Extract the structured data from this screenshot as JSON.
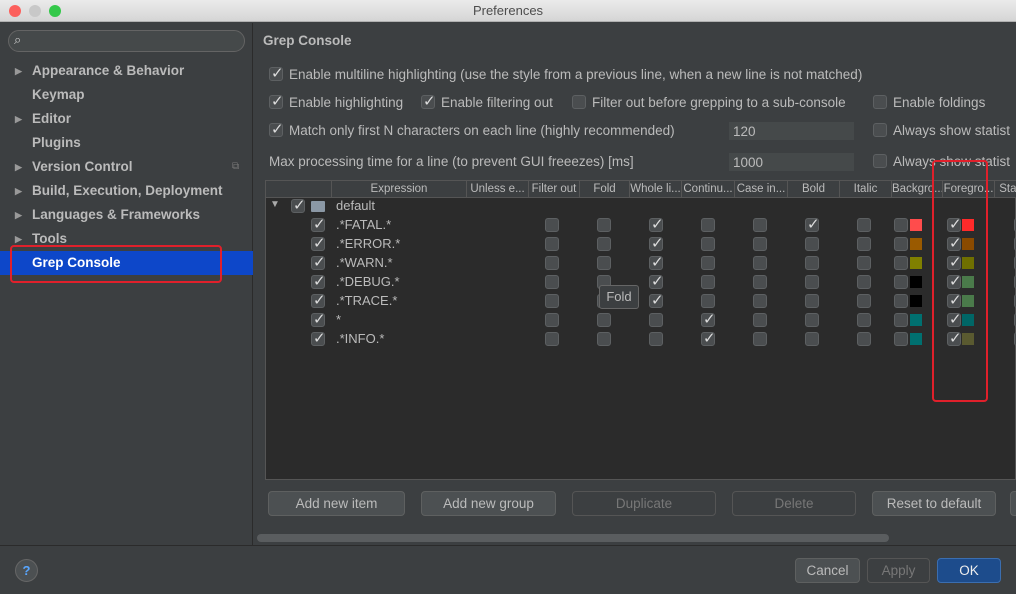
{
  "window": {
    "title": "Preferences"
  },
  "sidebar": {
    "search_placeholder": "",
    "items": [
      {
        "label": "Appearance & Behavior",
        "expandable": true
      },
      {
        "label": "Keymap",
        "expandable": false
      },
      {
        "label": "Editor",
        "expandable": true
      },
      {
        "label": "Plugins",
        "expandable": false
      },
      {
        "label": "Version Control",
        "expandable": true
      },
      {
        "label": "Build, Execution, Deployment",
        "expandable": true
      },
      {
        "label": "Languages & Frameworks",
        "expandable": true
      },
      {
        "label": "Tools",
        "expandable": true
      },
      {
        "label": "Grep Console",
        "expandable": false,
        "selected": true
      }
    ]
  },
  "main": {
    "title": "Grep Console",
    "options": {
      "multiline": {
        "label": "Enable multiline highlighting (use the style from a previous line, when a new line is not matched)",
        "checked": true
      },
      "highlighting": {
        "label": "Enable highlighting",
        "checked": true
      },
      "filtering": {
        "label": "Enable filtering out",
        "checked": true
      },
      "filter_before": {
        "label": "Filter out before grepping to a sub-console",
        "checked": false
      },
      "foldings": {
        "label": "Enable foldings",
        "checked": false
      },
      "match_first": {
        "label": "Match only first N characters on each line (highly recommended)",
        "checked": true,
        "value": "120"
      },
      "max_time": {
        "label": "Max processing time for a line (to prevent GUI freeezes) [ms]",
        "value": "1000"
      },
      "stats1": {
        "label": "Always show statist",
        "checked": false
      },
      "stats2": {
        "label": "Always show statist",
        "checked": false
      }
    },
    "table": {
      "columns": [
        "Expression",
        "Unless e...",
        "Filter out",
        "Fold",
        "Whole li...",
        "Continu...",
        "Case in...",
        "Bold",
        "Italic",
        "Backgro...",
        "Foregro...",
        "Stat"
      ],
      "group": {
        "label": "default",
        "checked": true
      },
      "rows": [
        {
          "expr": ".*FATAL.*",
          "filter": false,
          "fold": false,
          "whole": true,
          "cont": false,
          "case": false,
          "bold": true,
          "italic": false,
          "bg": false,
          "bg_color": "#ff4c4c",
          "fg": true,
          "fg_color": "#ff2a2a"
        },
        {
          "expr": ".*ERROR.*",
          "filter": false,
          "fold": false,
          "whole": true,
          "cont": false,
          "case": false,
          "bold": false,
          "italic": false,
          "bg": false,
          "bg_color": "#9a5a00",
          "fg": true,
          "fg_color": "#8a4a00"
        },
        {
          "expr": ".*WARN.*",
          "filter": false,
          "fold": false,
          "whole": true,
          "cont": false,
          "case": false,
          "bold": false,
          "italic": false,
          "bg": false,
          "bg_color": "#808000",
          "fg": true,
          "fg_color": "#6f6f00"
        },
        {
          "expr": ".*DEBUG.*",
          "filter": false,
          "fold": false,
          "whole": true,
          "cont": false,
          "case": false,
          "bold": false,
          "italic": false,
          "bg": false,
          "bg_color": "#000000",
          "fg": true,
          "fg_color": "#4a7a4a"
        },
        {
          "expr": ".*TRACE.*",
          "filter": false,
          "fold": false,
          "whole": true,
          "cont": false,
          "case": false,
          "bold": false,
          "italic": false,
          "bg": false,
          "bg_color": "#000000",
          "fg": true,
          "fg_color": "#4a7a4a"
        },
        {
          "expr": "*",
          "filter": false,
          "fold": false,
          "whole": false,
          "cont": true,
          "case": false,
          "bold": false,
          "italic": false,
          "bg": false,
          "bg_color": "#007070",
          "fg": true,
          "fg_color": "#006666"
        },
        {
          "expr": ".*INFO.*",
          "filter": false,
          "fold": false,
          "whole": false,
          "cont": true,
          "case": false,
          "bold": false,
          "italic": false,
          "bg": false,
          "bg_color": "#007070",
          "fg": true,
          "fg_color": "#5a5a30"
        }
      ]
    },
    "tooltip": "Fold",
    "buttons": {
      "add_item": "Add new item",
      "add_group": "Add new group",
      "duplicate": "Duplicate",
      "delete": "Delete",
      "reset": "Reset to default"
    }
  },
  "footer": {
    "help": "?",
    "cancel": "Cancel",
    "apply": "Apply",
    "ok": "OK"
  },
  "colors": {
    "selection": "#0d47c9",
    "highlight_box": "#e0202b"
  }
}
